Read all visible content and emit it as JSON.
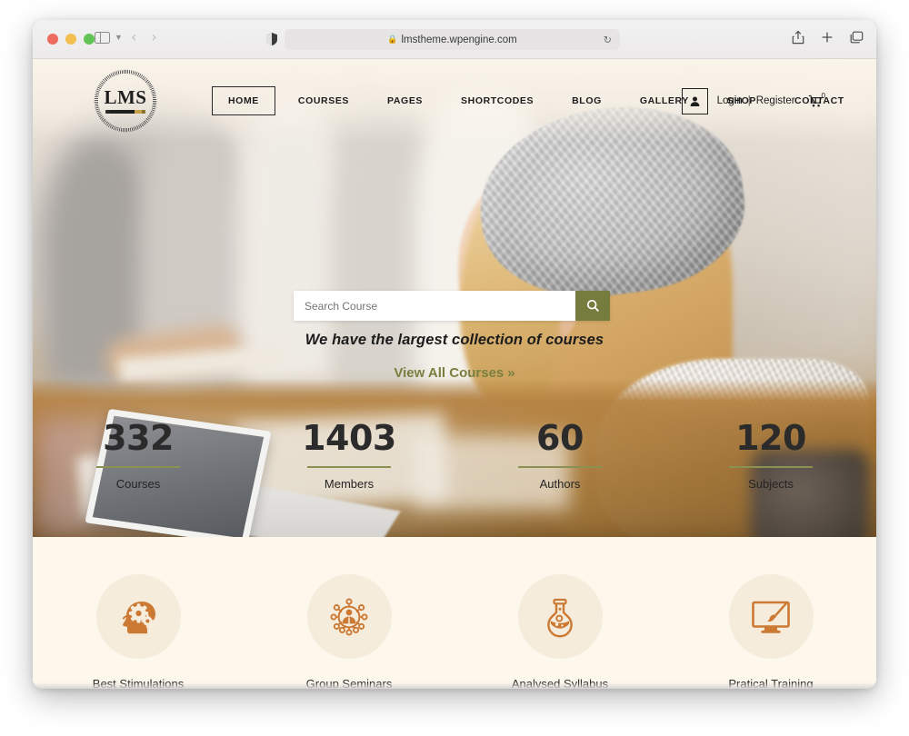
{
  "browser": {
    "url": "lmstheme.wpengine.com",
    "lock_icon": "lock-icon",
    "reload_icon": "reload-icon",
    "sidebar_icon": "sidebar-toggle-icon",
    "back_icon": "back-arrow-icon",
    "forward_icon": "forward-arrow-icon",
    "shield_icon": "privacy-shield-icon",
    "share_icon": "share-icon",
    "newtab_icon": "new-tab-icon",
    "tabs_icon": "tab-overview-icon"
  },
  "site": {
    "logo": {
      "text": "LMS",
      "icon": "lms-logo-icon"
    },
    "menu": [
      {
        "label": "HOME",
        "active": true
      },
      {
        "label": "COURSES",
        "active": false
      },
      {
        "label": "PAGES",
        "active": false
      },
      {
        "label": "SHORTCODES",
        "active": false
      },
      {
        "label": "BLOG",
        "active": false
      },
      {
        "label": "GALLERY",
        "active": false
      },
      {
        "label": "SHOP",
        "active": false
      },
      {
        "label": "CONTACT",
        "active": false
      }
    ],
    "account": {
      "user_icon": "user-account-icon",
      "login_label": "Login",
      "separator": "|",
      "register_label": "Register",
      "cart_icon": "shopping-cart-icon",
      "cart_count": "0"
    },
    "hero": {
      "search_placeholder": "Search Course",
      "search_value": "",
      "search_button_icon": "search-icon",
      "tagline": "We have the largest collection of courses",
      "cta_label": "View All Courses",
      "cta_chevron": "»"
    },
    "counters": [
      {
        "value": "332",
        "label": "Courses"
      },
      {
        "value": "1403",
        "label": "Members"
      },
      {
        "value": "60",
        "label": "Authors"
      },
      {
        "value": "120",
        "label": "Subjects"
      }
    ],
    "features": [
      {
        "label": "Best Stimulations",
        "icon": "head-gears-icon"
      },
      {
        "label": "Group Seminars",
        "icon": "group-network-icon"
      },
      {
        "label": "Analysed Syllabus",
        "icon": "flask-icon"
      },
      {
        "label": "Pratical Training",
        "icon": "monitor-brush-icon"
      }
    ]
  },
  "colors": {
    "accent_olive": "#767c3e",
    "cta_green": "#79803f",
    "feature_orange": "#cc7a33",
    "cream_bg": "#fdf7ec",
    "circle_bg": "#f5ecdc"
  }
}
